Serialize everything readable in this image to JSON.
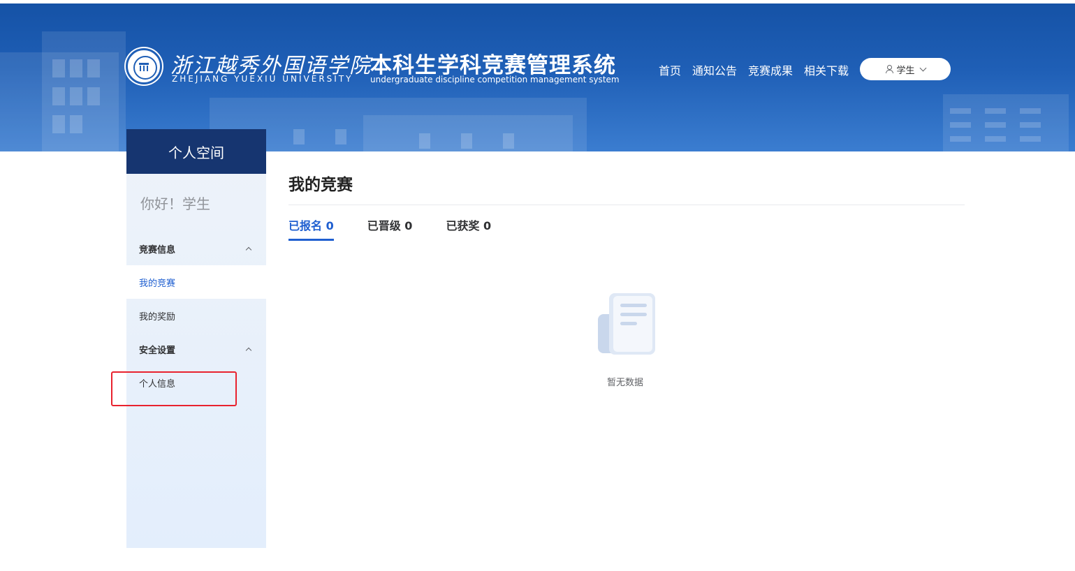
{
  "header": {
    "school_cn": "浙江越秀外国语学院",
    "school_en": "ZHEJIANG YUEXIU UNIVERSITY",
    "system_cn": "本科生学科竞赛管理系统",
    "system_en": "undergraduate discipline competition management system",
    "nav": [
      "首页",
      "通知公告",
      "竞赛成果",
      "相关下载"
    ],
    "user_label": "学生",
    "user_icon": "user-icon",
    "dropdown_icon": "chevron-down-icon"
  },
  "sidebar": {
    "title": "个人空间",
    "greeting": "你好！学生",
    "groups": [
      {
        "label": "竞赛信息",
        "items": [
          "我的竞赛",
          "我的奖励"
        ]
      },
      {
        "label": "安全设置",
        "items": [
          "个人信息"
        ]
      }
    ],
    "active_item": "我的竞赛"
  },
  "main": {
    "title": "我的竞赛",
    "tabs": [
      "已报名 0",
      "已晋级 0",
      "已获奖 0"
    ],
    "active_tab": "已报名 0",
    "empty_text": "暂无数据",
    "empty_icon": "document-icon"
  },
  "colors": {
    "banner": "#1552a6",
    "sidebar_header": "#163570",
    "accent": "#1f5fd0",
    "highlight": "#e8222e"
  }
}
